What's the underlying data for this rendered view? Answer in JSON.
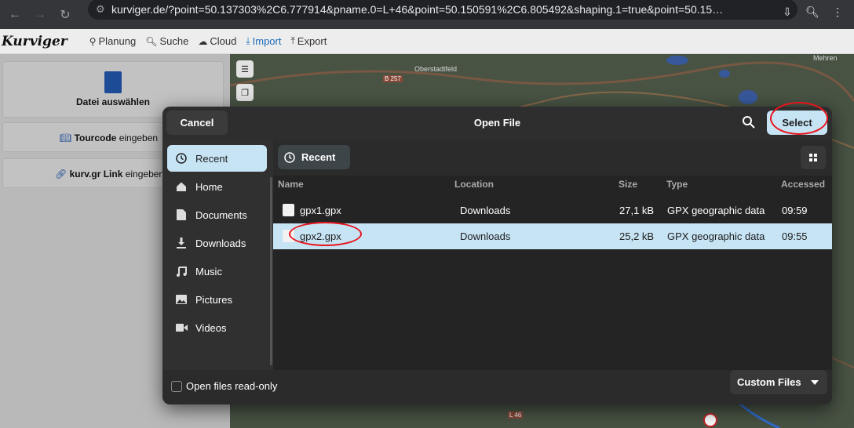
{
  "browser": {
    "url": "kurviger.de/?point=50.137303%2C6.777914&pname.0=L+46&point=50.150591%2C6.805492&shaping.1=true&point=50.15…",
    "icons": [
      "back-arrow-icon",
      "forward-arrow-icon",
      "reload-icon",
      "site-settings-icon",
      "install-app-icon",
      "zoom-icon",
      "more-icon"
    ]
  },
  "app": {
    "logo": "Kurviger",
    "menu": [
      {
        "label": "Planung",
        "icon": "route-icon"
      },
      {
        "label": "Suche",
        "icon": "search-icon"
      },
      {
        "label": "Cloud",
        "icon": "cloud-icon"
      },
      {
        "label": "Import",
        "icon": "import-icon",
        "active": true
      },
      {
        "label": "Export",
        "icon": "export-icon"
      }
    ]
  },
  "left_panel": {
    "file_button": "Datei auswählen",
    "tourcode_bold": "Tourcode",
    "tourcode_rest": " eingeben",
    "link_bold": "kurv.gr Link",
    "link_rest": " eingeben"
  },
  "map": {
    "labels": [
      "Oberstadtfeld",
      "Mehren",
      "B 257",
      "L 46"
    ],
    "controls": [
      "layers-icon",
      "copy-icon"
    ]
  },
  "dialog": {
    "title": "Open File",
    "cancel": "Cancel",
    "select": "Select",
    "sidebar": [
      {
        "label": "Recent",
        "icon": "clock-icon",
        "selected": true
      },
      {
        "label": "Home",
        "icon": "home-icon"
      },
      {
        "label": "Documents",
        "icon": "document-icon"
      },
      {
        "label": "Downloads",
        "icon": "download-icon"
      },
      {
        "label": "Music",
        "icon": "music-icon"
      },
      {
        "label": "Pictures",
        "icon": "pictures-icon"
      },
      {
        "label": "Videos",
        "icon": "video-icon"
      }
    ],
    "location_button": "Recent",
    "columns": {
      "name": "Name",
      "location": "Location",
      "size": "Size",
      "type": "Type",
      "accessed": "Accessed"
    },
    "files": [
      {
        "name": "gpx1.gpx",
        "location": "Downloads",
        "size": "27,1 kB",
        "type": "GPX geographic data",
        "accessed": "09:59",
        "selected": false
      },
      {
        "name": "gpx2.gpx",
        "location": "Downloads",
        "size": "25,2 kB",
        "type": "GPX geographic data",
        "accessed": "09:55",
        "selected": true
      }
    ],
    "readonly_label": "Open files read-only",
    "filter": "Custom Files"
  },
  "colors": {
    "accent": "#c7e4f5",
    "annotation": "#e8141c",
    "dialog_bg": "#242424"
  }
}
